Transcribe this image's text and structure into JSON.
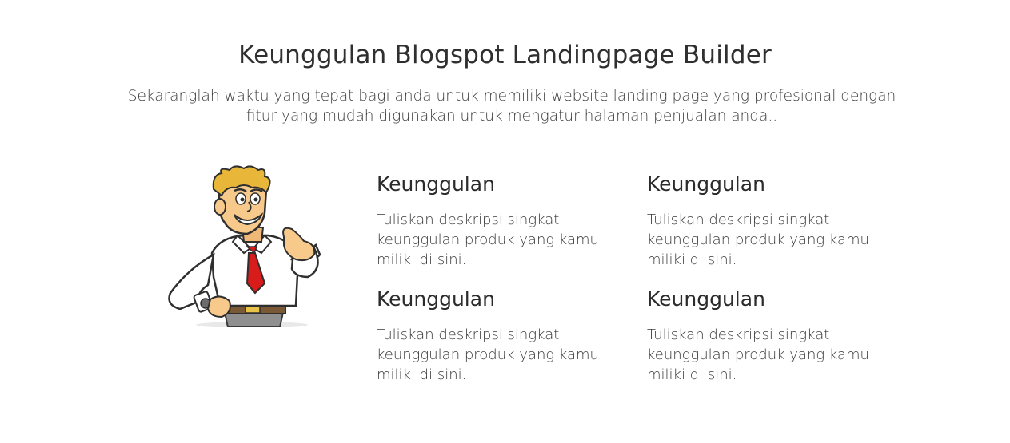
{
  "section": {
    "title": "Keunggulan Blogspot Landingpage Builder",
    "subtitle": "Sekaranglah waktu yang tepat bagi anda untuk memiliki website landing page yang profesional dengan fitur yang mudah digunakan untuk mengatur halaman penjualan anda.."
  },
  "mascot": {
    "icon": "businessman-thumbs-up-illustration"
  },
  "features": [
    {
      "title": "Keunggulan",
      "description": "Tuliskan deskripsi singkat keunggulan produk yang kamu miliki di sini."
    },
    {
      "title": "Keunggulan",
      "description": "Tuliskan deskripsi singkat keunggulan produk yang kamu miliki di sini."
    },
    {
      "title": "Keunggulan",
      "description": "Tuliskan deskripsi singkat keunggulan produk yang kamu miliki di sini."
    },
    {
      "title": "Keunggulan",
      "description": "Tuliskan deskripsi singkat keunggulan produk yang kamu miliki di sini."
    }
  ],
  "colors": {
    "text": "#333333",
    "skin": "#f7c98b",
    "hair": "#e8b73a",
    "tie": "#d81b1b",
    "shirt": "#ffffff"
  }
}
